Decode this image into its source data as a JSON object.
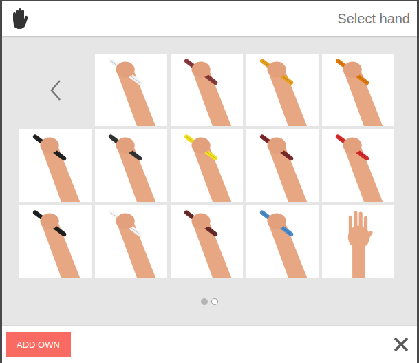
{
  "dialog": {
    "title": "Select hand"
  },
  "thumbnails": [
    {
      "kind": "pen",
      "color": "#f2f2f2"
    },
    {
      "kind": "pen",
      "color": "#8a3a3a"
    },
    {
      "kind": "pen",
      "color": "#e8a020"
    },
    {
      "kind": "pen",
      "color": "#e07a10"
    },
    {
      "kind": "pen",
      "color": "#222222"
    },
    {
      "kind": "pen",
      "color": "#333333"
    },
    {
      "kind": "pen",
      "color": "#f2e020"
    },
    {
      "kind": "pen",
      "color": "#7a2a2a"
    },
    {
      "kind": "pen",
      "color": "#d42a2a"
    },
    {
      "kind": "pen",
      "color": "#1e1e1e"
    },
    {
      "kind": "pen",
      "color": "#f5f5f5"
    },
    {
      "kind": "pen",
      "color": "#6a2a2a"
    },
    {
      "kind": "pen",
      "color": "#4a8ac8"
    },
    {
      "kind": "open",
      "color": "#e8a783"
    }
  ],
  "pagination": [
    {
      "selected": true
    },
    {
      "selected": false
    }
  ],
  "buttons": [
    "ADD OWN"
  ]
}
